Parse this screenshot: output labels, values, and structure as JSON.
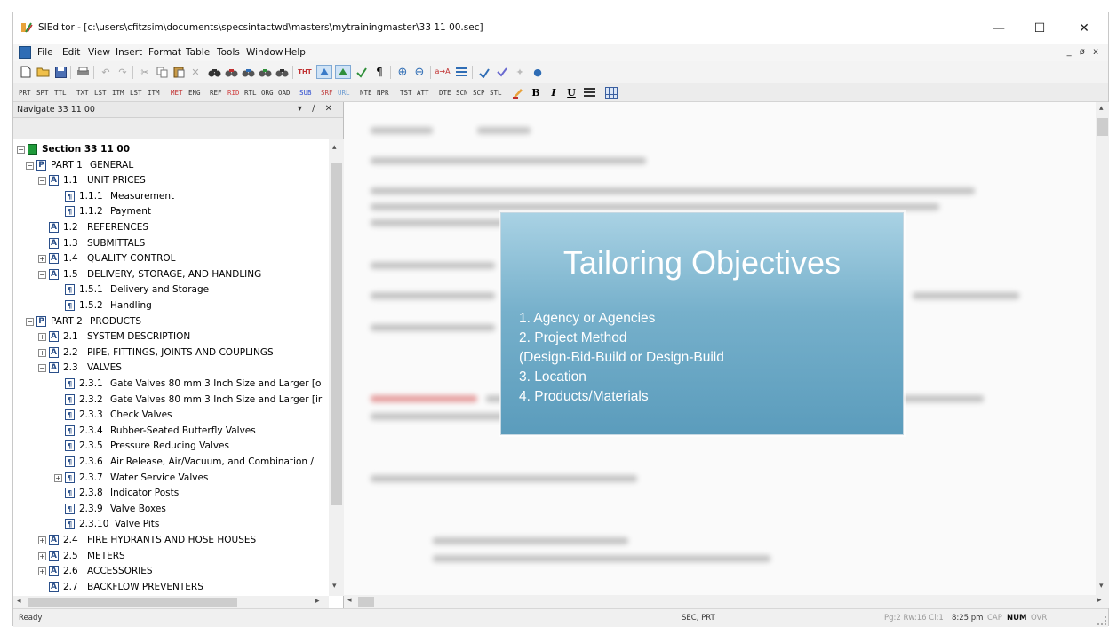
{
  "window": {
    "title": "SIEditor - [c:\\users\\cfitzsim\\documents\\specsintactwd\\masters\\mytrainingmaster\\33 11 00.sec]",
    "controls": [
      "—",
      "☐",
      "✕"
    ]
  },
  "menu": {
    "items": [
      "File",
      "Edit",
      "View",
      "Insert",
      "Format",
      "Table",
      "Tools",
      "Window",
      "Help"
    ],
    "mdi_controls": "_ ø x"
  },
  "tag_toolbar": [
    "PRT",
    "SPT",
    "TTL",
    "TXT",
    "LST",
    "ITM",
    "LST",
    "ITM",
    "MET",
    "ENG",
    "REF",
    "RID",
    "RTL",
    "ORG",
    "OAD",
    "SUB",
    "SRF",
    "URL",
    "NTE",
    "NPR",
    "TST",
    "ATT",
    "DTE",
    "SCN",
    "SCP",
    "STL"
  ],
  "nav": {
    "header": "Navigate 33 11 00",
    "controls": "▾ p ✕",
    "tree": [
      {
        "num": "Section 33 11 00",
        "label": "",
        "type": "section",
        "level": 0
      },
      {
        "num": "PART 1",
        "label": "GENERAL",
        "type": "part",
        "level": 1
      },
      {
        "num": "1.1",
        "label": "UNIT PRICES",
        "type": "article",
        "level": 2
      },
      {
        "num": "1.1.1",
        "label": "Measurement",
        "type": "para",
        "level": 3
      },
      {
        "num": "1.1.2",
        "label": "Payment",
        "type": "para",
        "level": 3
      },
      {
        "num": "1.2",
        "label": "REFERENCES",
        "type": "article",
        "level": 2
      },
      {
        "num": "1.3",
        "label": "SUBMITTALS",
        "type": "article",
        "level": 2
      },
      {
        "num": "1.4",
        "label": "QUALITY CONTROL",
        "type": "article",
        "level": 2
      },
      {
        "num": "1.5",
        "label": "DELIVERY, STORAGE, AND HANDLING",
        "type": "article",
        "level": 2
      },
      {
        "num": "1.5.1",
        "label": "Delivery and Storage",
        "type": "para",
        "level": 3
      },
      {
        "num": "1.5.2",
        "label": "Handling",
        "type": "para",
        "level": 3
      },
      {
        "num": "PART 2",
        "label": "PRODUCTS",
        "type": "part",
        "level": 1
      },
      {
        "num": "2.1",
        "label": "SYSTEM DESCRIPTION",
        "type": "article",
        "level": 2
      },
      {
        "num": "2.2",
        "label": "PIPE, FITTINGS, JOINTS AND COUPLINGS",
        "type": "article",
        "level": 2
      },
      {
        "num": "2.3",
        "label": "VALVES",
        "type": "article",
        "level": 2
      },
      {
        "num": "2.3.1",
        "label": "Gate Valves 80 mm 3 Inch Size and Larger [o",
        "type": "para",
        "level": 3
      },
      {
        "num": "2.3.2",
        "label": "Gate Valves 80 mm 3 Inch Size and Larger [ir",
        "type": "para",
        "level": 3
      },
      {
        "num": "2.3.3",
        "label": "Check Valves",
        "type": "para",
        "level": 3
      },
      {
        "num": "2.3.4",
        "label": "Rubber-Seated Butterfly Valves",
        "type": "para",
        "level": 3
      },
      {
        "num": "2.3.5",
        "label": "Pressure Reducing Valves",
        "type": "para",
        "level": 3
      },
      {
        "num": "2.3.6",
        "label": "Air Release, Air/Vacuum, and Combination /",
        "type": "para",
        "level": 3
      },
      {
        "num": "2.3.7",
        "label": "Water Service Valves",
        "type": "para",
        "level": 3
      },
      {
        "num": "2.3.8",
        "label": "Indicator Posts",
        "type": "para",
        "level": 3
      },
      {
        "num": "2.3.9",
        "label": "Valve Boxes",
        "type": "para",
        "level": 3
      },
      {
        "num": "2.3.10",
        "label": "Valve Pits",
        "type": "para",
        "level": 3
      },
      {
        "num": "2.4",
        "label": "FIRE HYDRANTS AND HOSE HOUSES",
        "type": "article",
        "level": 2
      },
      {
        "num": "2.5",
        "label": "METERS",
        "type": "article",
        "level": 2
      },
      {
        "num": "2.6",
        "label": "ACCESSORIES",
        "type": "article",
        "level": 2
      },
      {
        "num": "2.7",
        "label": "BACKFLOW PREVENTERS",
        "type": "article",
        "level": 2
      }
    ]
  },
  "slide": {
    "title": "Tailoring Objectives",
    "items": [
      "1.  Agency or Agencies",
      "2.  Project Method",
      "     (Design-Bid-Build or Design-Build",
      "3.  Location",
      "4.  Products/Materials"
    ]
  },
  "status": {
    "left": "Ready",
    "center": "SEC, PRT",
    "position": "Pg:2 Rw:16 Cl:1",
    "time": "8:25 pm",
    "cap": "CAP",
    "num": "NUM",
    "ovr": "OVR"
  }
}
